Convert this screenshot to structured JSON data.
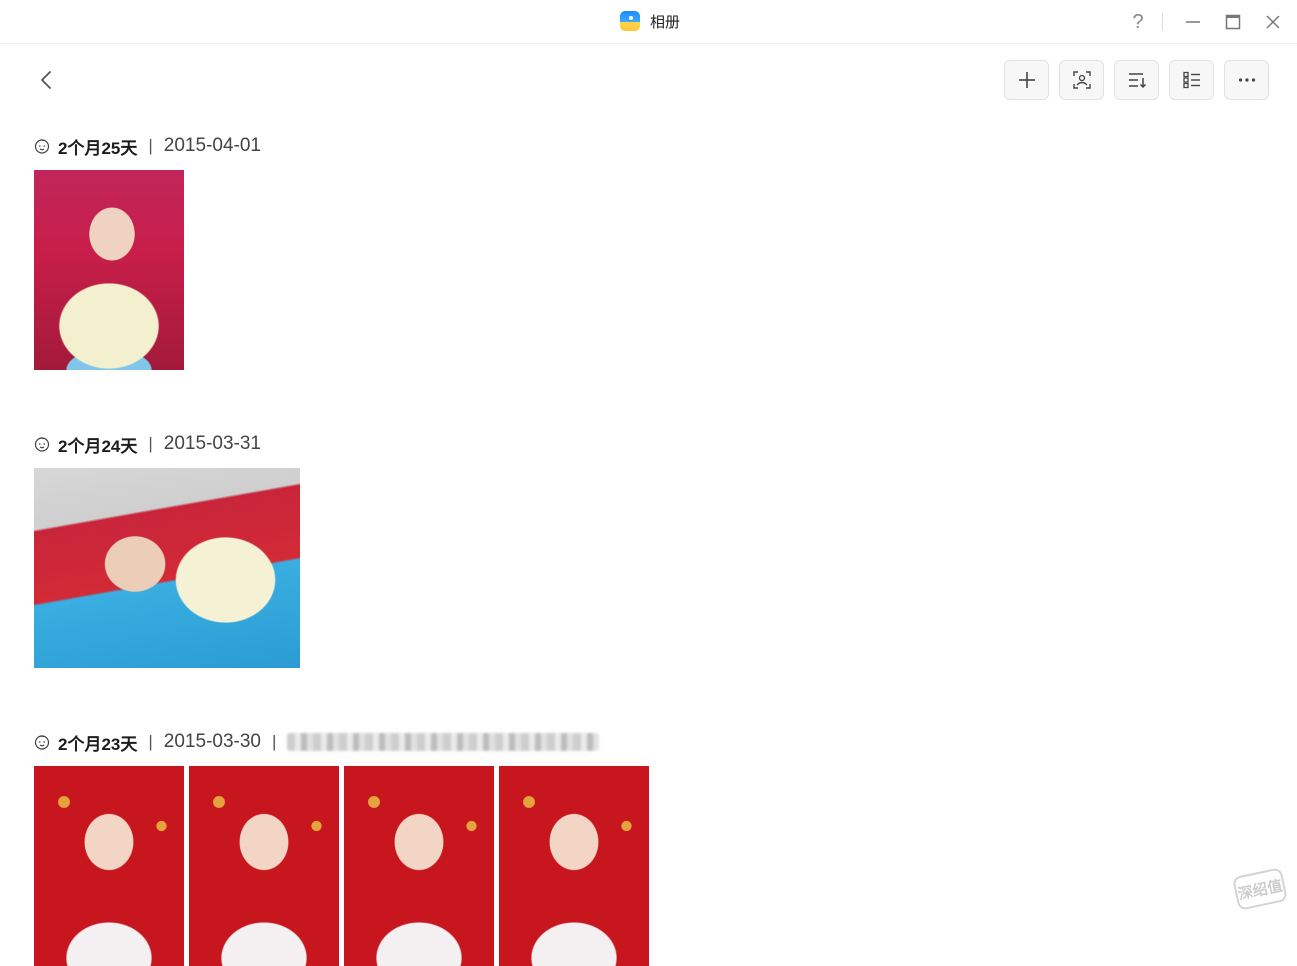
{
  "window": {
    "title": "相册",
    "help_label": "?",
    "minimize_label": "—",
    "maximize_label": "□",
    "close_label": "✕"
  },
  "toolbar": {
    "buttons": [
      {
        "icon": "plus-icon"
      },
      {
        "icon": "face-scan-icon"
      },
      {
        "icon": "sort-icon"
      },
      {
        "icon": "list-view-icon"
      },
      {
        "icon": "more-icon"
      }
    ]
  },
  "groups": [
    {
      "age": "2个月25天",
      "separator": "|",
      "date": "2015-04-01",
      "photo_count": 1
    },
    {
      "age": "2个月24天",
      "separator": "|",
      "date": "2015-03-31",
      "photo_count": 1
    },
    {
      "age": "2个月23天",
      "separator": "|",
      "date": "2015-03-30",
      "photo_count": 4,
      "location_redacted": true
    }
  ],
  "watermark": {
    "text": "深绍值"
  }
}
